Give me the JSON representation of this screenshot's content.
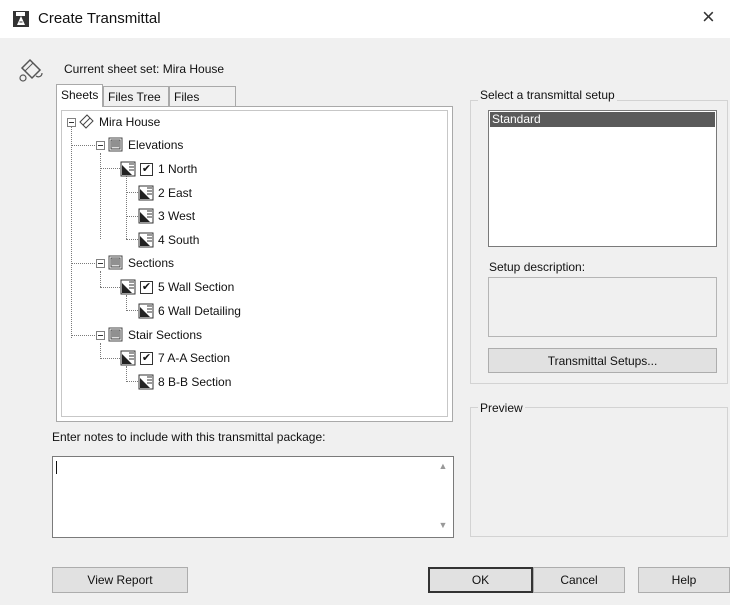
{
  "window": {
    "title": "Create Transmittal",
    "close_glyph": "×",
    "app_icon": "autocad-icon"
  },
  "sheet_set": {
    "label": "Current sheet set: Mira House",
    "icon": "sheet-set-icon"
  },
  "tabs": [
    {
      "label": "Sheets",
      "active": true
    },
    {
      "label": "Files Tree",
      "active": false
    },
    {
      "label": "Files Table",
      "active": false
    }
  ],
  "tree": {
    "root": "Mira House",
    "groups": [
      {
        "name": "Elevations",
        "sheets": [
          {
            "label": "1 North",
            "checked": true
          },
          {
            "label": "2 East",
            "checked": false
          },
          {
            "label": "3 West",
            "checked": false
          },
          {
            "label": "4 South",
            "checked": false
          }
        ]
      },
      {
        "name": "Sections",
        "sheets": [
          {
            "label": "5 Wall Section",
            "checked": true
          },
          {
            "label": "6 Wall Detailing",
            "checked": false
          }
        ]
      },
      {
        "name": "Stair Sections",
        "sheets": [
          {
            "label": "7 A-A Section",
            "checked": true
          },
          {
            "label": "8 B-B Section",
            "checked": false
          }
        ]
      }
    ]
  },
  "notes": {
    "label": "Enter notes to include with this transmittal package:",
    "value": ""
  },
  "setup": {
    "group_title": "Select a transmittal setup",
    "items": [
      "Standard"
    ],
    "selected": "Standard",
    "description_label": "Setup description:",
    "description_value": "",
    "setups_button": "Transmittal Setups..."
  },
  "preview": {
    "group_title": "Preview"
  },
  "buttons": {
    "view_report": "View Report",
    "ok": "OK",
    "cancel": "Cancel",
    "help": "Help"
  },
  "colors": {
    "selection": "#5a5a5a",
    "window_bg": "#f0f0f0"
  }
}
